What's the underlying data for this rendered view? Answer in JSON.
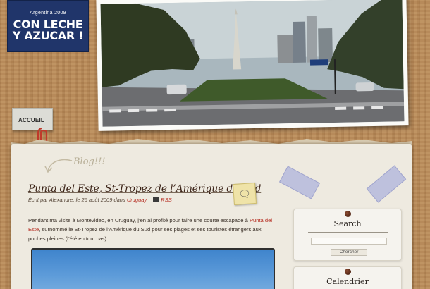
{
  "header": {
    "subtitle": "Argentina 2009",
    "site_title": "CON LECHE Y AZUCAR !"
  },
  "nav": {
    "home_label": "ACCUEIL"
  },
  "blog_tag": "Blog!!!",
  "post": {
    "title": "Punta del Este, St-Tropez de l’Amérique du Sud",
    "meta_prefix": "Écrit par Alexandre, le 26 août 2009 dans ",
    "category": "Uruguay",
    "meta_sep": " | ",
    "rss": "RSS",
    "comment_icon": "speech-bubble-icon",
    "body_before_link": "Pendant ma visite à Montevideo, en Uruguay, j’en ai profité pour faire une courte escapade à ",
    "body_link": "Punta del Este",
    "body_after_link": ", surnommé le St-Tropez de l’Amérique du Sud pour ses plages et ses touristes étrangers aux poches pleines (l’été en tout cas)."
  },
  "sidebar": {
    "search": {
      "title": "Search",
      "input_value": "",
      "button_label": "Chercher"
    },
    "calendar": {
      "title": "Calendrier"
    }
  },
  "colors": {
    "logo_bg": "#20356a",
    "link": "#b52a1e",
    "paper": "#eeeae0",
    "wood": "#b88a58"
  }
}
